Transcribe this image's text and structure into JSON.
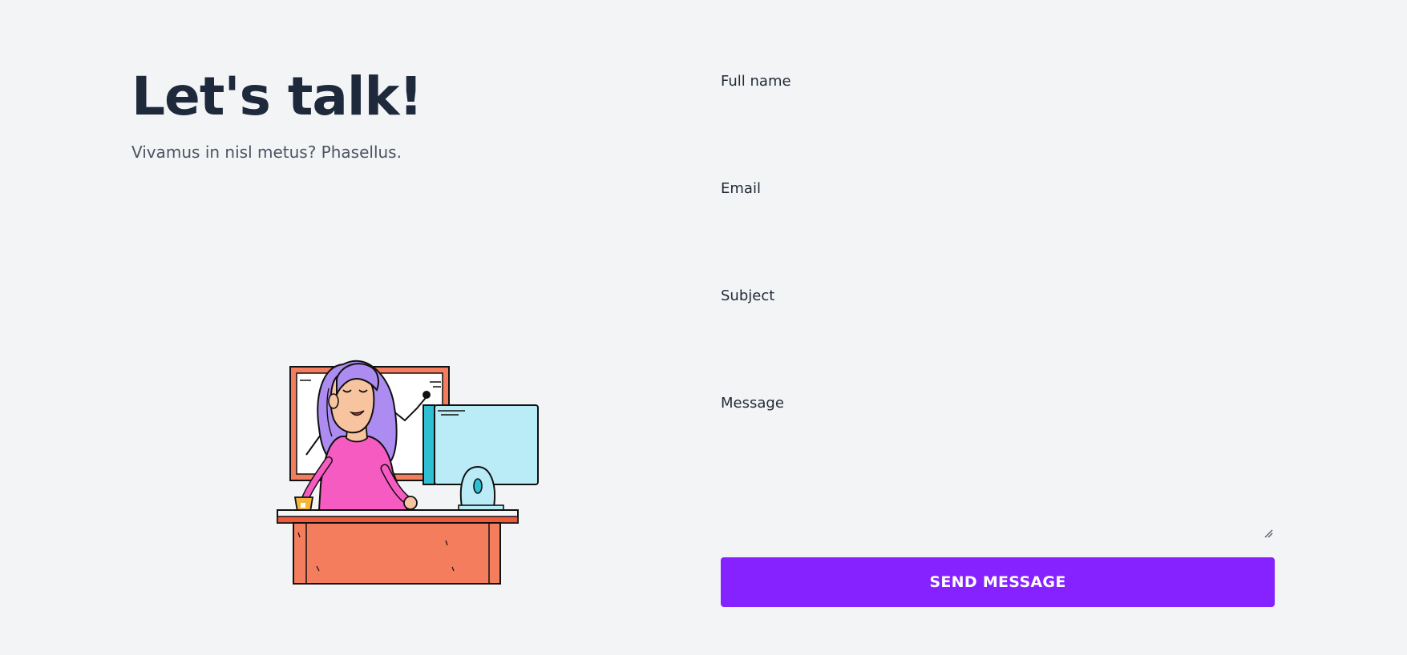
{
  "hero": {
    "headline": "Let's talk!",
    "subline": "Vivamus in nisl metus? Phasellus."
  },
  "form": {
    "full_name_label": "Full name",
    "full_name_value": "",
    "email_label": "Email",
    "email_value": "",
    "subject_label": "Subject",
    "subject_value": "",
    "message_label": "Message",
    "message_value": "",
    "submit_label": "SEND MESSAGE"
  },
  "illustration": {
    "icon": "woman-at-desk-illustration"
  },
  "colors": {
    "background": "#f3f4f6",
    "heading": "#1e293b",
    "subtext": "#4b5563",
    "accent": "#8522ff"
  }
}
